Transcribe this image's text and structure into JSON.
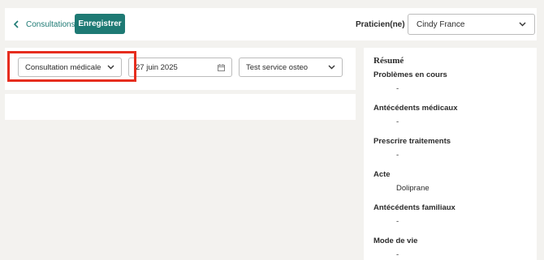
{
  "header": {
    "back_label": "Consultations",
    "save_label": "Enregistrer",
    "praticien_label": "Praticien(ne)",
    "praticien_value": "Cindy France"
  },
  "form": {
    "type_value": "Consultation médicale",
    "date_value": "27 juin 2025",
    "service_value": "Test service osteo"
  },
  "summary": {
    "title": "Résumé",
    "sections": [
      {
        "title": "Problèmes en cours",
        "value": "-"
      },
      {
        "title": "Antécédents médicaux",
        "value": "-"
      },
      {
        "title": "Prescrire traitements",
        "value": "-"
      },
      {
        "title": "Acte",
        "value": "Doliprane"
      },
      {
        "title": "Antécédents familiaux",
        "value": "-"
      },
      {
        "title": "Mode de vie",
        "value": "-"
      }
    ]
  },
  "colors": {
    "accent": "#1e7a74",
    "highlight": "#e62d1e",
    "background": "#f3f2ef"
  }
}
